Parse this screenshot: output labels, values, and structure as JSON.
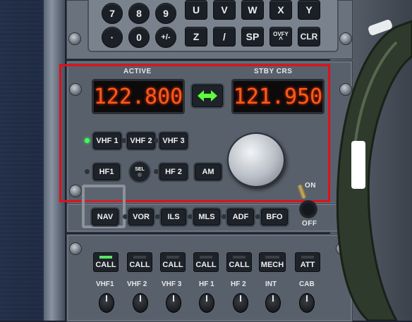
{
  "keypad": {
    "row1": [
      "7",
      "8",
      "9",
      "U",
      "V",
      "W",
      "X",
      "Y"
    ],
    "row2": [
      "·",
      "0",
      "+/-",
      "Z",
      "/",
      "SP",
      "OVFY",
      "CLR"
    ]
  },
  "radio": {
    "active_label": "ACTIVE",
    "standby_label": "STBY CRS",
    "active_freq": "122.800",
    "standby_freq": "121.950",
    "transfer_icon": "double-arrow-icon",
    "buttons_row1": [
      "VHF 1",
      "VHF 2",
      "VHF 3"
    ],
    "buttons_row2": [
      "HF1",
      "SEL",
      "HF 2",
      "AM"
    ],
    "nav_buttons": [
      "NAV",
      "VOR",
      "ILS",
      "MLS",
      "ADF",
      "BFO"
    ],
    "switch_on": "ON",
    "switch_off": "OFF",
    "active_led": "VHF 1",
    "led_color": "#3cff5a",
    "freq_color": "#ff5a1a",
    "highlight_color": "#e0101a"
  },
  "audio": {
    "call_buttons": [
      "CALL",
      "CALL",
      "CALL",
      "CALL",
      "CALL",
      "MECH",
      "ATT"
    ],
    "knob_labels": [
      "VHF1",
      "VHF 2",
      "VHF 3",
      "HF 1",
      "HF 2",
      "INT",
      "CAB"
    ]
  }
}
